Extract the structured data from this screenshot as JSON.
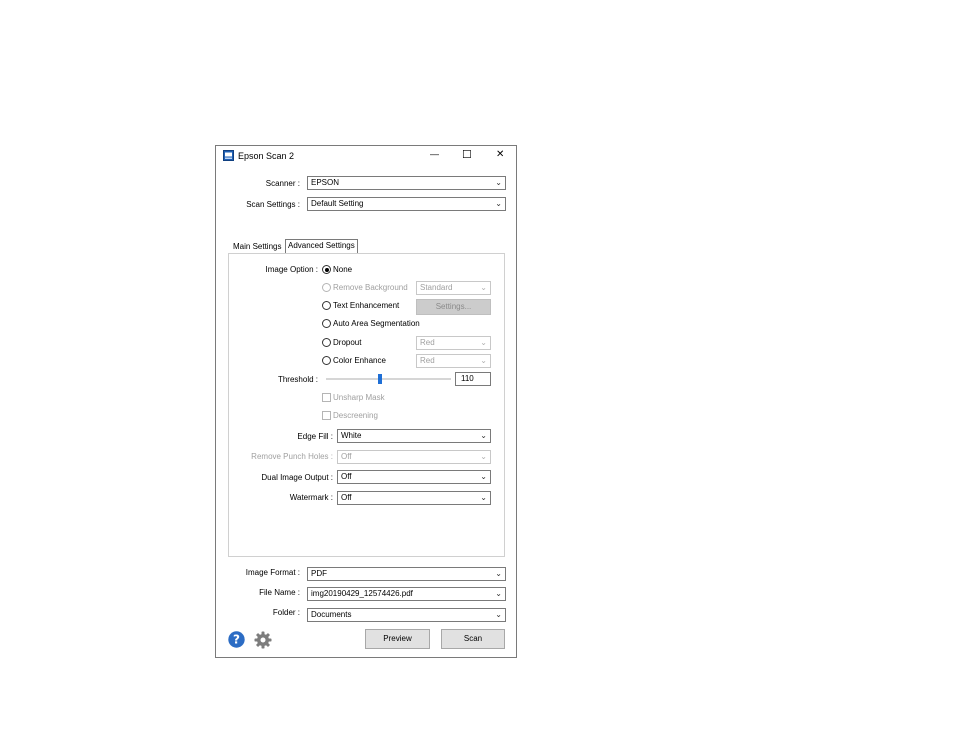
{
  "window": {
    "title": "Epson Scan 2",
    "minimize_glyph": "—",
    "maximize_glyph": "☐",
    "close_glyph": "✕",
    "icon": "epson-scan-app-icon"
  },
  "scanner": {
    "label": "Scanner :",
    "value": "EPSON"
  },
  "scan_settings": {
    "label": "Scan Settings :",
    "value": "Default Setting"
  },
  "tabs": [
    {
      "label": "Main Settings",
      "active": false
    },
    {
      "label": "Advanced Settings",
      "active": true
    }
  ],
  "advanced": {
    "image_option": {
      "label": "Image Option :",
      "options": {
        "none": {
          "label": "None",
          "selected": true
        },
        "remove_background": {
          "label": "Remove Background",
          "enabled": false,
          "dropdown": "Standard"
        },
        "text_enhancement": {
          "label": "Text Enhancement",
          "button": "Settings..."
        },
        "auto_area_segmentation": {
          "label": "Auto Area Segmentation"
        },
        "dropout": {
          "label": "Dropout",
          "dropdown": "Red"
        },
        "color_enhance": {
          "label": "Color Enhance",
          "dropdown": "Red"
        }
      }
    },
    "threshold": {
      "label": "Threshold :",
      "value": "110",
      "level": 110,
      "max": 255
    },
    "unsharp_mask": {
      "label": "Unsharp Mask",
      "checked": false
    },
    "descreening": {
      "label": "Descreening",
      "checked": false
    },
    "edge_fill": {
      "label": "Edge Fill :",
      "value": "White"
    },
    "remove_punch_holes": {
      "label": "Remove Punch Holes :",
      "value": "Off"
    },
    "dual_image_output": {
      "label": "Dual Image Output :",
      "value": "Off"
    },
    "watermark": {
      "label": "Watermark :",
      "value": "Off"
    }
  },
  "image_format": {
    "label": "Image Format :",
    "value": "PDF"
  },
  "file_name": {
    "label": "File Name :",
    "value": "img20190429_12574426.pdf"
  },
  "folder": {
    "label": "Folder :",
    "value": "Documents"
  },
  "footer": {
    "help_icon": "question-icon",
    "settings_icon": "gear-icon",
    "preview_label": "Preview",
    "scan_label": "Scan"
  },
  "colors": {
    "help_blue": "#2b6cc4",
    "gear_gray": "#7d7d7d",
    "slider_thumb": "#1f6fd6"
  }
}
